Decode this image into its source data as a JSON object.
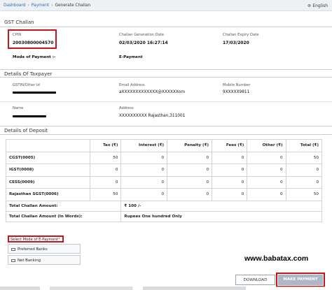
{
  "breadcrumb": {
    "items": [
      "Dashboard",
      "Payment",
      "Generate Challan"
    ],
    "language": "English"
  },
  "gst_challan": {
    "title": "GST Challan",
    "cpin_label": "CPIN",
    "cpin_value": "20030800004570",
    "gen_date_label": "Challan Generation Date",
    "gen_date_value": "02/03/2020 16:27:14",
    "exp_date_label": "Challan Expiry Date",
    "exp_date_value": "17/03/2020",
    "mode_label": "Mode of Payment :-",
    "mode_value": "E-Payment"
  },
  "taxpayer": {
    "title": "Details Of Taxpayer",
    "gstin_label": "GSTIN/Other Id",
    "email_label": "Email Address",
    "email_value": "aXXXXXXXXXXXXX@XXXXXXom",
    "mobile_label": "Mobile Number",
    "mobile_value": "9XXXXX9811",
    "name_label": "Name",
    "address_label": "Address",
    "address_value": "XXXXXXXXXX Rajasthan,311001"
  },
  "deposit": {
    "title": "Details of Deposit",
    "columns": [
      "Tax (₹)",
      "Interest (₹)",
      "Penalty (₹)",
      "Fees (₹)",
      "Other (₹)",
      "Total (₹)"
    ],
    "rows": [
      {
        "label": "CGST(0005)",
        "tax": "50",
        "interest": "0",
        "penalty": "0",
        "fees": "0",
        "other": "0",
        "total": "50"
      },
      {
        "label": "IGST(0008)",
        "tax": "0",
        "interest": "0",
        "penalty": "0",
        "fees": "0",
        "other": "0",
        "total": "0"
      },
      {
        "label": "CESS(0009)",
        "tax": "0",
        "interest": "0",
        "penalty": "0",
        "fees": "0",
        "other": "0",
        "total": "0"
      },
      {
        "label": "Rajasthan SGST(0006)",
        "tax": "50",
        "interest": "0",
        "penalty": "0",
        "fees": "0",
        "other": "0",
        "total": "50"
      }
    ],
    "total_amount_label": "Total Challan Amount:",
    "total_amount_value": "₹ 100 /-",
    "total_words_label": "Total Challan Amount (In Words):",
    "total_words_value": "Rupees One hundred Only"
  },
  "payment": {
    "select_label": "Select Mode of E-Payment",
    "required_mark": "*",
    "options": [
      "Preferred Banks",
      "Net Banking"
    ]
  },
  "watermark": "www.babatax.com",
  "buttons": {
    "download": "DOWNLOAD",
    "make_payment": "MAKE PAYMENT"
  }
}
